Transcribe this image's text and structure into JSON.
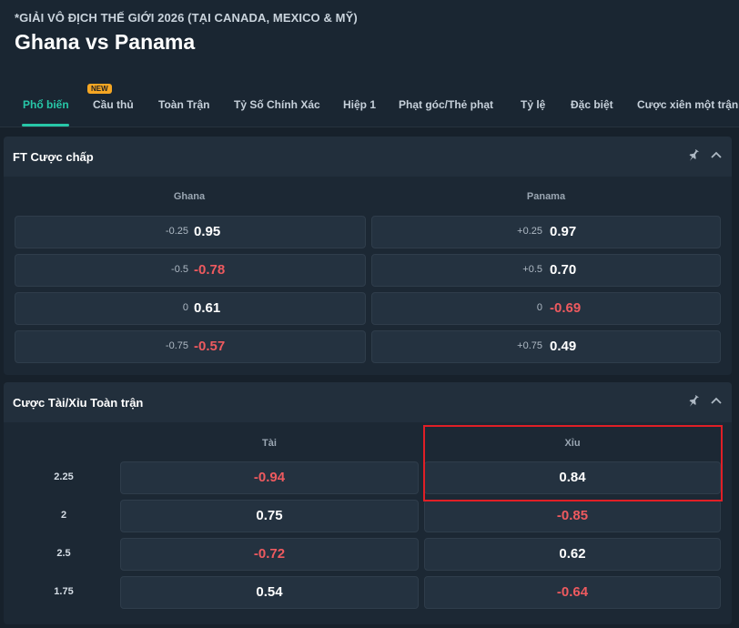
{
  "header": {
    "league": "*GIẢI VÔ ĐỊCH THẾ GIỚI 2026 (TẠI CANADA, MEXICO & MỸ)",
    "title": "Ghana vs Panama"
  },
  "tabs": [
    {
      "label": "Phổ biến",
      "active": true
    },
    {
      "label": "Cầu thủ",
      "badge": "NEW"
    },
    {
      "label": "Toàn Trận"
    },
    {
      "label": "Tỷ Số Chính Xác"
    },
    {
      "label": "Hiệp 1"
    },
    {
      "label": "Phạt góc/Thẻ phạt"
    },
    {
      "label": "Tỷ lệ"
    },
    {
      "label": "Đặc biệt"
    },
    {
      "label": "Cược xiên một trận"
    }
  ],
  "handicap": {
    "title": "FT Cược chấp",
    "home": "Ghana",
    "away": "Panama",
    "rows": [
      {
        "home_line": "-0.25",
        "home_price": "0.95",
        "away_line": "+0.25",
        "away_price": "0.97"
      },
      {
        "home_line": "-0.5",
        "home_price": "-0.78",
        "away_line": "+0.5",
        "away_price": "0.70"
      },
      {
        "home_line": "0",
        "home_price": "0.61",
        "away_line": "0",
        "away_price": "-0.69"
      },
      {
        "home_line": "-0.75",
        "home_price": "-0.57",
        "away_line": "+0.75",
        "away_price": "0.49"
      }
    ]
  },
  "overunder": {
    "title": "Cược Tài/Xỉu Toàn trận",
    "over": "Tài",
    "under": "Xỉu",
    "rows": [
      {
        "line": "2.25",
        "over": "-0.94",
        "under": "0.84"
      },
      {
        "line": "2",
        "over": "0.75",
        "under": "-0.85"
      },
      {
        "line": "2.5",
        "over": "-0.72",
        "under": "0.62"
      },
      {
        "line": "1.75",
        "over": "0.54",
        "under": "-0.64"
      }
    ]
  },
  "colors": {
    "accent": "#27c7a8",
    "negative": "#ee5a5f",
    "highlight": "#e01f26"
  }
}
